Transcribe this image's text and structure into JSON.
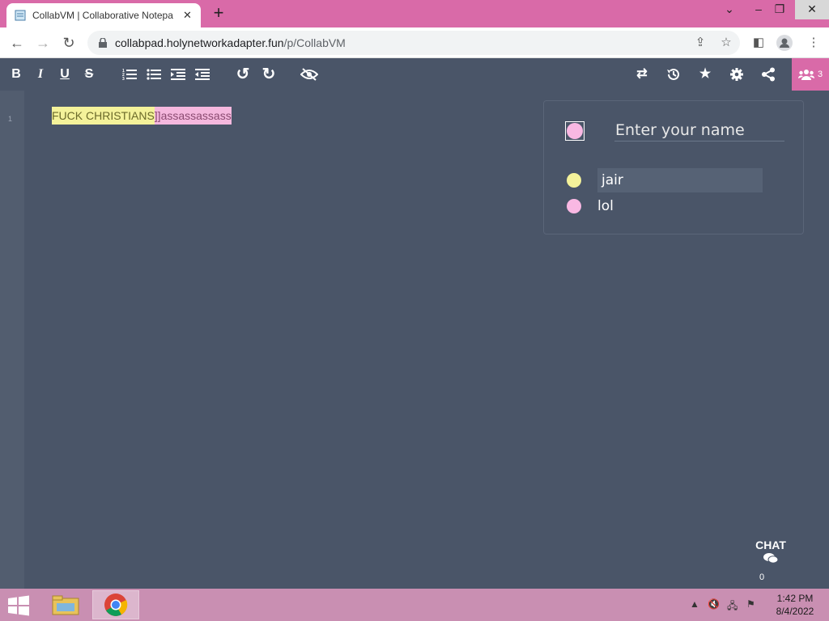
{
  "browser": {
    "tab_title": "CollabVM | Collaborative Notepa",
    "url_host": "collabpad.holynetworkadapter.fun",
    "url_path": "/p/CollabVM"
  },
  "editor": {
    "line_number": "1",
    "seg1": "FUCK CHRISTIANS",
    "seg2": "]]assassassass"
  },
  "toolbar": {
    "left_icons": [
      "bold-icon",
      "italic-icon",
      "underline-icon",
      "strikethrough-icon",
      "ordered-list-icon",
      "unordered-list-icon",
      "indent-icon",
      "outdent-icon",
      "undo-icon",
      "redo-icon",
      "hide-authorship-icon"
    ],
    "right_icons": [
      "import-export-icon",
      "timeslider-icon",
      "star-icon",
      "settings-icon",
      "share-icon"
    ],
    "user_count": "3"
  },
  "users_panel": {
    "name_placeholder": "Enter your name",
    "my_color": "#f9b8e3",
    "users": [
      {
        "name": "jair",
        "color": "#f4f29a"
      },
      {
        "name": "lol",
        "color": "#f9b8e3"
      }
    ]
  },
  "chat": {
    "label": "CHAT",
    "count": "0"
  },
  "taskbar": {
    "time": "1:42 PM",
    "date": "8/4/2022"
  }
}
